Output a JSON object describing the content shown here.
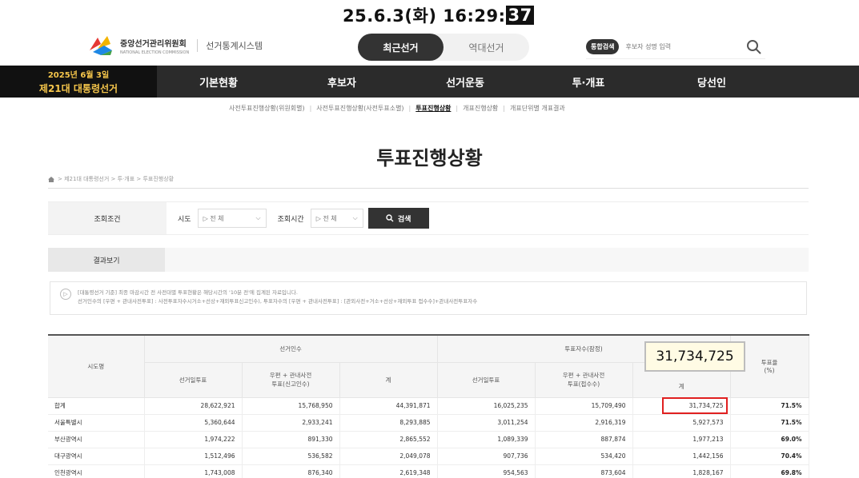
{
  "overlay": {
    "timestamp": "25.6.3(화) 16:29:",
    "seconds": "37"
  },
  "header": {
    "logo_text": "중앙선거관리위원회",
    "logo_sub": "NATIONAL ELECTION COMMISSION",
    "system_name": "선거통계시스템",
    "tabs": [
      {
        "label": "최근선거",
        "active": true
      },
      {
        "label": "역대선거",
        "active": false
      }
    ],
    "search_badge": "통합검색",
    "search_placeholder": "후보자 성명 입력"
  },
  "election": {
    "date": "2025년 6월 3일",
    "name": "제21대 대통령선거"
  },
  "nav": [
    "기본현황",
    "후보자",
    "선거운동",
    "투·개표",
    "당선인"
  ],
  "subnav": [
    {
      "label": "사전투표진행상황(위원회별)",
      "active": false
    },
    {
      "label": "사전투표진행상황(사전투표소별)",
      "active": false
    },
    {
      "label": "투표진행상황",
      "active": true
    },
    {
      "label": "개표진행상황",
      "active": false
    },
    {
      "label": "개표단위별 개표결과",
      "active": false
    }
  ],
  "page_title": "투표진행상황",
  "breadcrumb": "> 제21대 대통령선거 > 투·개표 > 투표진행상황",
  "filter": {
    "label": "조회조건",
    "city_label": "시도",
    "city_value": "▷ 전 체",
    "time_label": "조회시간",
    "time_value": "▷ 전 체",
    "search_label": "검색"
  },
  "result_label": "결과보기",
  "notice": {
    "line1": "[대통령선거 기준] 최종 마감시간 전 사전대별 투표현황은 해당시간의 '10분 전'에 집계된 자료입니다.",
    "line2": "선거인수의 [우편 + 관내사전투표] : 사전투표자수시거소+선상+재외투표신고인수), 투표자수의 [우편 + 관내사전투표] : [관외사전+거소+선상+재외투표 접수수]+관내사전투표자수"
  },
  "table": {
    "region_header": "시도명",
    "electors_group": "선거인수",
    "voters_group": "투표자수(잠정)",
    "sub_election_day": "선거일투표",
    "sub_mail_advance": "우편 + 관내사전",
    "sub_mail_advance2_electors": "투표(신고인수)",
    "sub_mail_advance2_voters": "투표(접수수)",
    "sub_total": "계",
    "rate_header": "투표율",
    "rate_unit": "(%)",
    "rows": [
      {
        "region": "합계",
        "e_day": "28,622,921",
        "e_mail": "15,768,950",
        "e_total": "44,391,871",
        "v_day": "16,025,235",
        "v_mail": "15,709,490",
        "v_total": "31,734,725",
        "rate": "71.5%"
      },
      {
        "region": "서울특별시",
        "e_day": "5,360,644",
        "e_mail": "2,933,241",
        "e_total": "8,293,885",
        "v_day": "3,011,254",
        "v_mail": "2,916,319",
        "v_total": "5,927,573",
        "rate": "71.5%"
      },
      {
        "region": "부산광역시",
        "e_day": "1,974,222",
        "e_mail": "891,330",
        "e_total": "2,865,552",
        "v_day": "1,089,339",
        "v_mail": "887,874",
        "v_total": "1,977,213",
        "rate": "69.0%"
      },
      {
        "region": "대구광역시",
        "e_day": "1,512,496",
        "e_mail": "536,582",
        "e_total": "2,049,078",
        "v_day": "907,736",
        "v_mail": "534,420",
        "v_total": "1,442,156",
        "rate": "70.4%"
      },
      {
        "region": "인천광역시",
        "e_day": "1,743,008",
        "e_mail": "876,340",
        "e_total": "2,619,348",
        "v_day": "954,563",
        "v_mail": "873,604",
        "v_total": "1,828,167",
        "rate": "69.8%"
      }
    ]
  },
  "callout": "31,734,725",
  "colors": {
    "nav_bg": "#2b2b2b",
    "badge_text": "#f6c64b",
    "highlight_red": "#e02020",
    "callout_bg": "#fffbe4"
  }
}
